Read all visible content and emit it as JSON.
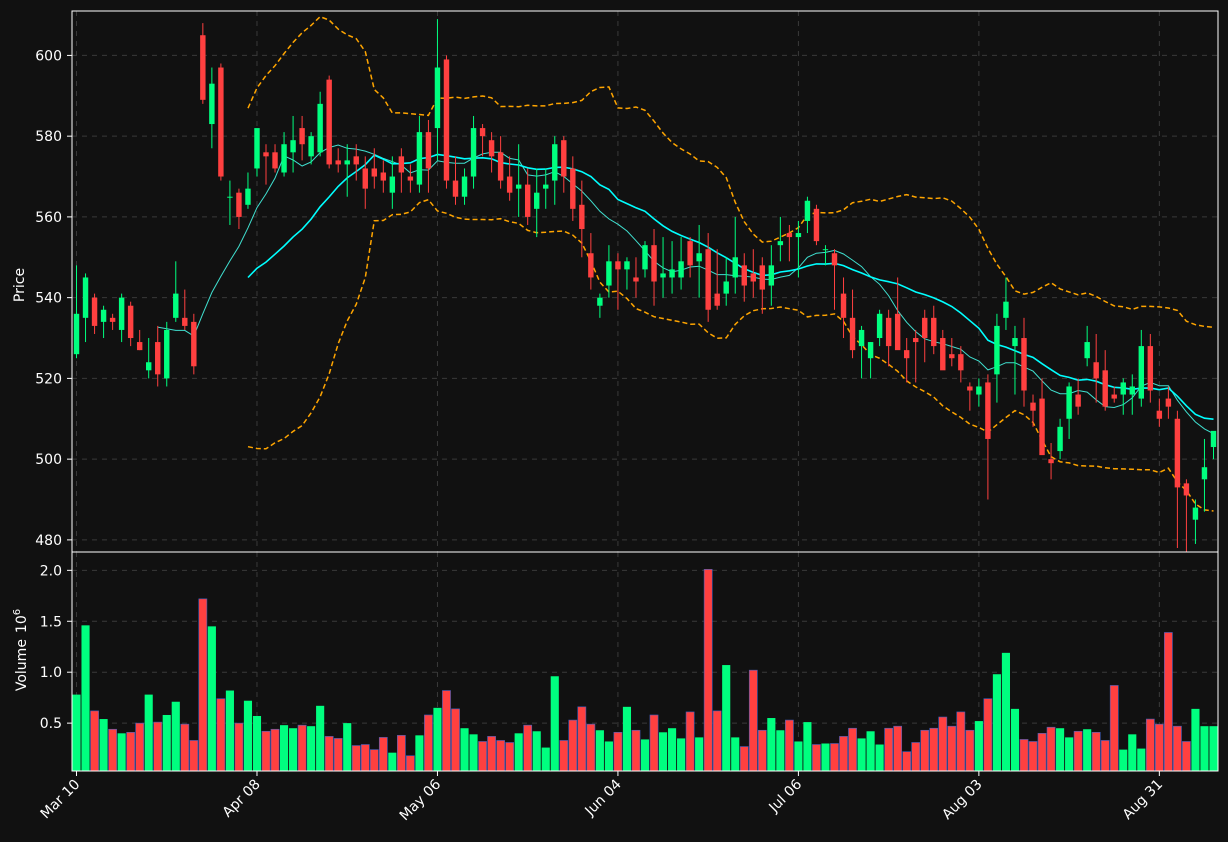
{
  "chart_data": {
    "type": "candlestick",
    "colors": {
      "background": "#111111",
      "up": "#00ff7f",
      "down": "#ff4040",
      "sma_fast": "#40e0d0",
      "sma_slow": "#00ffff",
      "bollinger": "#ffa500",
      "axis": "#ffffff",
      "grid": "#3a3a3a"
    },
    "grid": true,
    "price_panel": {
      "ylabel": "Price",
      "ylim": [
        477,
        611
      ],
      "yticks": [
        480,
        500,
        520,
        540,
        560,
        580,
        600
      ]
    },
    "volume_panel": {
      "ylabel": "Volume",
      "ylabel_multiplier": "10",
      "ylabel_exponent": "6",
      "ylim": [
        0.03,
        2.18
      ],
      "yticks": [
        0.5,
        1.0,
        1.5,
        2.0
      ],
      "ytick_labels": [
        "0.5",
        "1.0",
        "1.5",
        "2.0"
      ]
    },
    "xlim": [
      -0.5,
      126.5
    ],
    "x_ticks": [
      {
        "index": 0,
        "label": "Mar 10"
      },
      {
        "index": 20,
        "label": "Apr 08"
      },
      {
        "index": 40,
        "label": "May 06"
      },
      {
        "index": 60,
        "label": "Jun 04"
      },
      {
        "index": 80,
        "label": "Jul 06"
      },
      {
        "index": 100,
        "label": "Aug 03"
      },
      {
        "index": 120,
        "label": "Aug 31"
      }
    ],
    "ohlc": [
      [
        526,
        548,
        525,
        536
      ],
      [
        535,
        546,
        529,
        545
      ],
      [
        540,
        541,
        531,
        533
      ],
      [
        534,
        538,
        530,
        537
      ],
      [
        535,
        536,
        532,
        534
      ],
      [
        532,
        541,
        529,
        540
      ],
      [
        538,
        539,
        528,
        530
      ],
      [
        529,
        532,
        527,
        527
      ],
      [
        522,
        530,
        520,
        524
      ],
      [
        529,
        533,
        518,
        521
      ],
      [
        520,
        534,
        518,
        532
      ],
      [
        535,
        549,
        534,
        541
      ],
      [
        535,
        542,
        532,
        533
      ],
      [
        534,
        536,
        521,
        523
      ],
      [
        605,
        608,
        588,
        589
      ],
      [
        583,
        597,
        577,
        593
      ],
      [
        597,
        598,
        569,
        570
      ],
      [
        565,
        569,
        558,
        565
      ],
      [
        566,
        567,
        557,
        560
      ],
      [
        563,
        571,
        562,
        567
      ],
      [
        572,
        577,
        570,
        582
      ],
      [
        576,
        578,
        568,
        575
      ],
      [
        576,
        578,
        571,
        572
      ],
      [
        571,
        581,
        570,
        578
      ],
      [
        576,
        585,
        571,
        579
      ],
      [
        582,
        585,
        574,
        578
      ],
      [
        575,
        581,
        573,
        580
      ],
      [
        576,
        591,
        575,
        588
      ],
      [
        594,
        595,
        572,
        573
      ],
      [
        574,
        577,
        571,
        573
      ],
      [
        573,
        578,
        565,
        574
      ],
      [
        575,
        578,
        569,
        573
      ],
      [
        572,
        575,
        562,
        567
      ],
      [
        572,
        577,
        567,
        570
      ],
      [
        571,
        574,
        566,
        569
      ],
      [
        566,
        575,
        562,
        570
      ],
      [
        575,
        577,
        566,
        571
      ],
      [
        570,
        573,
        566,
        569
      ],
      [
        568,
        585,
        566,
        581
      ],
      [
        581,
        584,
        566,
        572
      ],
      [
        582,
        609,
        574,
        597
      ],
      [
        599,
        600,
        567,
        569
      ],
      [
        569,
        575,
        563,
        565
      ],
      [
        565,
        572,
        563,
        570
      ],
      [
        570,
        585,
        567,
        582
      ],
      [
        582,
        583,
        575,
        580
      ],
      [
        579,
        581,
        571,
        575
      ],
      [
        576,
        580,
        567,
        569
      ],
      [
        570,
        575,
        564,
        566
      ],
      [
        567,
        578,
        560,
        568
      ],
      [
        568,
        572,
        558,
        560
      ],
      [
        562,
        572,
        555,
        566
      ],
      [
        567,
        572,
        562,
        568
      ],
      [
        569,
        580,
        563,
        578
      ],
      [
        579,
        580,
        566,
        570
      ],
      [
        572,
        575,
        559,
        562
      ],
      [
        563,
        569,
        550,
        557
      ],
      [
        551,
        556,
        542,
        545
      ],
      [
        538,
        541,
        535,
        540
      ],
      [
        543,
        553,
        540,
        549
      ],
      [
        549,
        551,
        537,
        547
      ],
      [
        547,
        550,
        542,
        549
      ],
      [
        545,
        550,
        540,
        544
      ],
      [
        547,
        554,
        545,
        553
      ],
      [
        553,
        557,
        538,
        544
      ],
      [
        545,
        555,
        540,
        546
      ],
      [
        545,
        554,
        541,
        547
      ],
      [
        545,
        555,
        542,
        549
      ],
      [
        554,
        555,
        545,
        548
      ],
      [
        549,
        558,
        540,
        551
      ],
      [
        552,
        556,
        534,
        537
      ],
      [
        541,
        552,
        537,
        538
      ],
      [
        541,
        550,
        538,
        544
      ],
      [
        545,
        560,
        541,
        550
      ],
      [
        548,
        551,
        539,
        543
      ],
      [
        546,
        552,
        540,
        544
      ],
      [
        548,
        550,
        536,
        542
      ],
      [
        543,
        553,
        538,
        548
      ],
      [
        553,
        560,
        549,
        554
      ],
      [
        556,
        558,
        549,
        555
      ],
      [
        555,
        559,
        545,
        556
      ],
      [
        559,
        565,
        556,
        564
      ],
      [
        562,
        563,
        553,
        554
      ],
      [
        552,
        553,
        548,
        552
      ],
      [
        551,
        552,
        537,
        548
      ],
      [
        541,
        545,
        530,
        535
      ],
      [
        535,
        542,
        525,
        527
      ],
      [
        528,
        533,
        520,
        532
      ],
      [
        525,
        529,
        520,
        529
      ],
      [
        530,
        537,
        528,
        536
      ],
      [
        535,
        537,
        523,
        528
      ],
      [
        536,
        545,
        530,
        527
      ],
      [
        527,
        530,
        519,
        525
      ],
      [
        530,
        532,
        519,
        529
      ],
      [
        535,
        537,
        524,
        530
      ],
      [
        535,
        538,
        526,
        528
      ],
      [
        530,
        532,
        524,
        522
      ],
      [
        526,
        530,
        523,
        525
      ],
      [
        526,
        528,
        519,
        522
      ],
      [
        518,
        519,
        512,
        517
      ],
      [
        516,
        520,
        513,
        518
      ],
      [
        519,
        521,
        490,
        505
      ],
      [
        521,
        536,
        514,
        533
      ],
      [
        535,
        545,
        532,
        539
      ],
      [
        528,
        533,
        516,
        530
      ],
      [
        530,
        535,
        513,
        517
      ],
      [
        514,
        516,
        508,
        512
      ],
      [
        515,
        520,
        503,
        501
      ],
      [
        500,
        504,
        495,
        499
      ],
      [
        502,
        510,
        500,
        508
      ],
      [
        510,
        519,
        505,
        518
      ],
      [
        516,
        520,
        511,
        513
      ],
      [
        525,
        533,
        523,
        529
      ],
      [
        524,
        531,
        514,
        520
      ],
      [
        522,
        527,
        512,
        513
      ],
      [
        516,
        518,
        514,
        515
      ],
      [
        516,
        520,
        511,
        519
      ],
      [
        516,
        521,
        511,
        518
      ],
      [
        515,
        532,
        513,
        528
      ],
      [
        528,
        531,
        514,
        517
      ],
      [
        512,
        515,
        508,
        510
      ],
      [
        515,
        518,
        510,
        513
      ],
      [
        510,
        512,
        478,
        493
      ],
      [
        494,
        495,
        477,
        491
      ],
      [
        485,
        490,
        479,
        488
      ],
      [
        495,
        505,
        487,
        498
      ],
      [
        503,
        506,
        500,
        507
      ]
    ],
    "volume": [
      0.78,
      1.46,
      0.62,
      0.54,
      0.44,
      0.4,
      0.41,
      0.5,
      0.78,
      0.51,
      0.58,
      0.71,
      0.49,
      0.33,
      1.72,
      1.45,
      0.74,
      0.82,
      0.5,
      0.72,
      0.57,
      0.42,
      0.44,
      0.48,
      0.45,
      0.48,
      0.47,
      0.67,
      0.37,
      0.35,
      0.5,
      0.28,
      0.29,
      0.24,
      0.36,
      0.21,
      0.38,
      0.18,
      0.38,
      0.58,
      0.65,
      0.82,
      0.64,
      0.45,
      0.39,
      0.32,
      0.37,
      0.33,
      0.31,
      0.4,
      0.48,
      0.42,
      0.26,
      0.96,
      0.33,
      0.53,
      0.66,
      0.49,
      0.43,
      0.32,
      0.41,
      0.66,
      0.43,
      0.34,
      0.58,
      0.41,
      0.45,
      0.35,
      0.61,
      0.36,
      2.01,
      0.62,
      1.07,
      0.36,
      0.27,
      1.02,
      0.43,
      0.55,
      0.43,
      0.53,
      0.32,
      0.51,
      0.29,
      0.3,
      0.3,
      0.37,
      0.45,
      0.35,
      0.42,
      0.29,
      0.45,
      0.47,
      0.22,
      0.31,
      0.43,
      0.45,
      0.56,
      0.47,
      0.61,
      0.43,
      0.52,
      0.74,
      0.98,
      1.19,
      0.64,
      0.34,
      0.32,
      0.4,
      0.46,
      0.45,
      0.36,
      0.42,
      0.44,
      0.41,
      0.33,
      0.87,
      0.24,
      0.39,
      0.25,
      0.54,
      0.49,
      1.39,
      0.47,
      0.32,
      0.64,
      0.47,
      0.47
    ]
  }
}
